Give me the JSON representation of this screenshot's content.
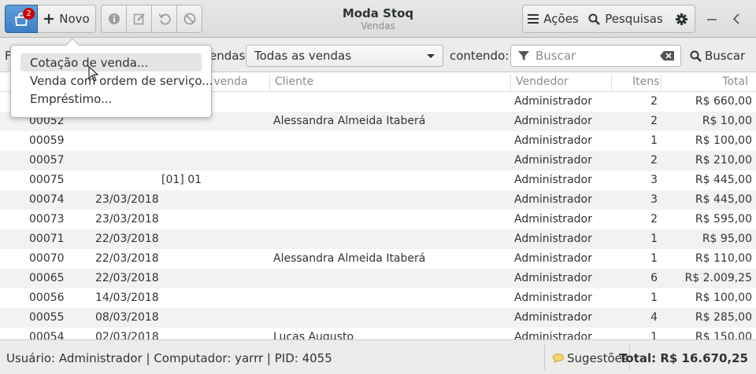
{
  "header": {
    "app_badge": "2",
    "novo_label": "Novo",
    "title": "Moda Stoq",
    "subtitle": "Vendas",
    "acoes_label": "Ações",
    "pesquisas_label": "Pesquisas"
  },
  "filter": {
    "label_prefix": "F",
    "label_tipo": "endas",
    "combo_value": "Todas as vendas",
    "contendo_label": "contendo:",
    "search_placeholder": "Buscar",
    "buscar_label": "Buscar"
  },
  "table": {
    "columns": {
      "data_venda": "n venda",
      "cliente": "Cliente",
      "vendedor": "Vendedor",
      "itens": "Itens",
      "total": "Total"
    },
    "rows": [
      {
        "num": "",
        "date": "",
        "desc": "",
        "client": "",
        "seller": "Administrador",
        "items": "2",
        "total": "R$ 660,00"
      },
      {
        "num": "00052",
        "date": "",
        "desc": "",
        "client": "Alessandra Almeida Itaberá",
        "seller": "Administrador",
        "items": "2",
        "total": "R$ 10,00"
      },
      {
        "num": "00059",
        "date": "",
        "desc": "",
        "client": "",
        "seller": "Administrador",
        "items": "1",
        "total": "R$ 100,00"
      },
      {
        "num": "00057",
        "date": "",
        "desc": "",
        "client": "",
        "seller": "Administrador",
        "items": "2",
        "total": "R$ 210,00"
      },
      {
        "num": "00075",
        "date": "",
        "desc": "[01] 01",
        "client": "",
        "seller": "Administrador",
        "items": "3",
        "total": "R$ 445,00"
      },
      {
        "num": "00074",
        "date": "23/03/2018",
        "desc": "",
        "client": "",
        "seller": "Administrador",
        "items": "3",
        "total": "R$ 445,00"
      },
      {
        "num": "00073",
        "date": "23/03/2018",
        "desc": "",
        "client": "",
        "seller": "Administrador",
        "items": "2",
        "total": "R$ 595,00"
      },
      {
        "num": "00071",
        "date": "22/03/2018",
        "desc": "",
        "client": "",
        "seller": "Administrador",
        "items": "1",
        "total": "R$ 95,00"
      },
      {
        "num": "00070",
        "date": "22/03/2018",
        "desc": "",
        "client": "Alessandra Almeida Itaberá",
        "seller": "Administrador",
        "items": "1",
        "total": "R$ 110,00"
      },
      {
        "num": "00065",
        "date": "22/03/2018",
        "desc": "",
        "client": "",
        "seller": "Administrador",
        "items": "6",
        "total": "R$ 2.009,25"
      },
      {
        "num": "00056",
        "date": "14/03/2018",
        "desc": "",
        "client": "",
        "seller": "Administrador",
        "items": "1",
        "total": "R$ 100,00"
      },
      {
        "num": "00055",
        "date": "08/03/2018",
        "desc": "",
        "client": "",
        "seller": "Administrador",
        "items": "4",
        "total": "R$ 285,00"
      },
      {
        "num": "00054",
        "date": "02/03/2018",
        "desc": "",
        "client": "Lucas Augusto",
        "seller": "Administrador",
        "items": "1",
        "total": "R$ 150,00"
      }
    ]
  },
  "menu": {
    "items": [
      "Cotação de venda...",
      "Venda com ordem de serviço...",
      "Empréstimo..."
    ]
  },
  "status": {
    "text": "Usuário: Administrador  |  Computador: yarrr  |  PID: 4055",
    "sugestoes": "Sugestões",
    "total": "Total: R$ 16.670,25"
  },
  "colors": {
    "accent": "#3e7fc4",
    "badge": "#cc0000"
  }
}
